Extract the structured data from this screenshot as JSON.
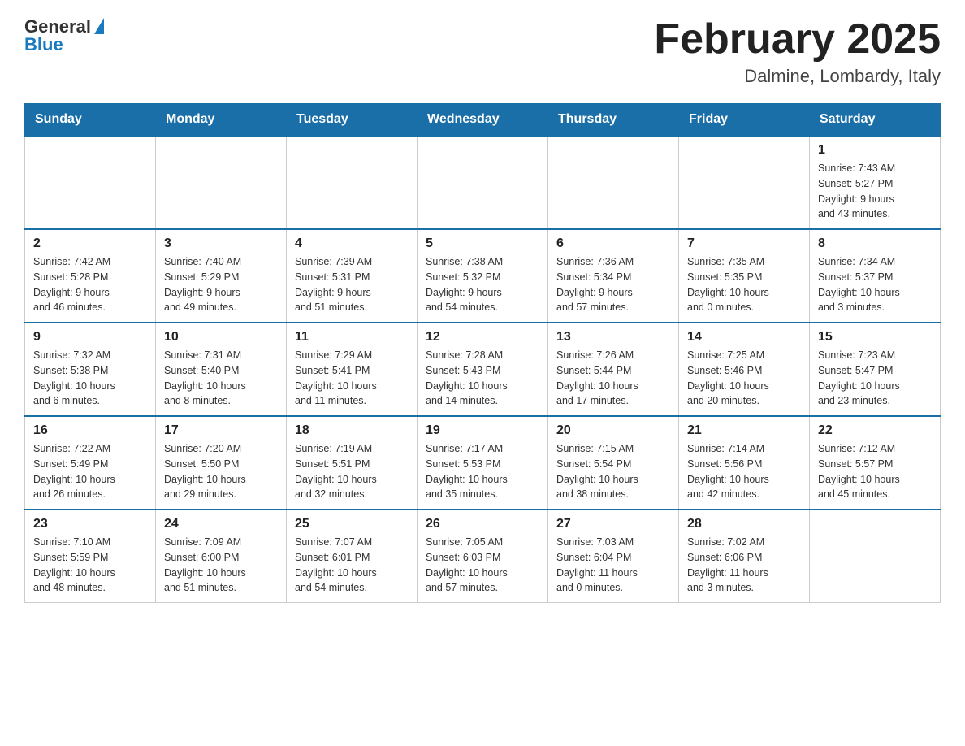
{
  "header": {
    "logo_general": "General",
    "logo_blue": "Blue",
    "title": "February 2025",
    "subtitle": "Dalmine, Lombardy, Italy"
  },
  "days_of_week": [
    "Sunday",
    "Monday",
    "Tuesday",
    "Wednesday",
    "Thursday",
    "Friday",
    "Saturday"
  ],
  "weeks": [
    {
      "days": [
        {
          "num": "",
          "info": ""
        },
        {
          "num": "",
          "info": ""
        },
        {
          "num": "",
          "info": ""
        },
        {
          "num": "",
          "info": ""
        },
        {
          "num": "",
          "info": ""
        },
        {
          "num": "",
          "info": ""
        },
        {
          "num": "1",
          "info": "Sunrise: 7:43 AM\nSunset: 5:27 PM\nDaylight: 9 hours\nand 43 minutes."
        }
      ]
    },
    {
      "days": [
        {
          "num": "2",
          "info": "Sunrise: 7:42 AM\nSunset: 5:28 PM\nDaylight: 9 hours\nand 46 minutes."
        },
        {
          "num": "3",
          "info": "Sunrise: 7:40 AM\nSunset: 5:29 PM\nDaylight: 9 hours\nand 49 minutes."
        },
        {
          "num": "4",
          "info": "Sunrise: 7:39 AM\nSunset: 5:31 PM\nDaylight: 9 hours\nand 51 minutes."
        },
        {
          "num": "5",
          "info": "Sunrise: 7:38 AM\nSunset: 5:32 PM\nDaylight: 9 hours\nand 54 minutes."
        },
        {
          "num": "6",
          "info": "Sunrise: 7:36 AM\nSunset: 5:34 PM\nDaylight: 9 hours\nand 57 minutes."
        },
        {
          "num": "7",
          "info": "Sunrise: 7:35 AM\nSunset: 5:35 PM\nDaylight: 10 hours\nand 0 minutes."
        },
        {
          "num": "8",
          "info": "Sunrise: 7:34 AM\nSunset: 5:37 PM\nDaylight: 10 hours\nand 3 minutes."
        }
      ]
    },
    {
      "days": [
        {
          "num": "9",
          "info": "Sunrise: 7:32 AM\nSunset: 5:38 PM\nDaylight: 10 hours\nand 6 minutes."
        },
        {
          "num": "10",
          "info": "Sunrise: 7:31 AM\nSunset: 5:40 PM\nDaylight: 10 hours\nand 8 minutes."
        },
        {
          "num": "11",
          "info": "Sunrise: 7:29 AM\nSunset: 5:41 PM\nDaylight: 10 hours\nand 11 minutes."
        },
        {
          "num": "12",
          "info": "Sunrise: 7:28 AM\nSunset: 5:43 PM\nDaylight: 10 hours\nand 14 minutes."
        },
        {
          "num": "13",
          "info": "Sunrise: 7:26 AM\nSunset: 5:44 PM\nDaylight: 10 hours\nand 17 minutes."
        },
        {
          "num": "14",
          "info": "Sunrise: 7:25 AM\nSunset: 5:46 PM\nDaylight: 10 hours\nand 20 minutes."
        },
        {
          "num": "15",
          "info": "Sunrise: 7:23 AM\nSunset: 5:47 PM\nDaylight: 10 hours\nand 23 minutes."
        }
      ]
    },
    {
      "days": [
        {
          "num": "16",
          "info": "Sunrise: 7:22 AM\nSunset: 5:49 PM\nDaylight: 10 hours\nand 26 minutes."
        },
        {
          "num": "17",
          "info": "Sunrise: 7:20 AM\nSunset: 5:50 PM\nDaylight: 10 hours\nand 29 minutes."
        },
        {
          "num": "18",
          "info": "Sunrise: 7:19 AM\nSunset: 5:51 PM\nDaylight: 10 hours\nand 32 minutes."
        },
        {
          "num": "19",
          "info": "Sunrise: 7:17 AM\nSunset: 5:53 PM\nDaylight: 10 hours\nand 35 minutes."
        },
        {
          "num": "20",
          "info": "Sunrise: 7:15 AM\nSunset: 5:54 PM\nDaylight: 10 hours\nand 38 minutes."
        },
        {
          "num": "21",
          "info": "Sunrise: 7:14 AM\nSunset: 5:56 PM\nDaylight: 10 hours\nand 42 minutes."
        },
        {
          "num": "22",
          "info": "Sunrise: 7:12 AM\nSunset: 5:57 PM\nDaylight: 10 hours\nand 45 minutes."
        }
      ]
    },
    {
      "days": [
        {
          "num": "23",
          "info": "Sunrise: 7:10 AM\nSunset: 5:59 PM\nDaylight: 10 hours\nand 48 minutes."
        },
        {
          "num": "24",
          "info": "Sunrise: 7:09 AM\nSunset: 6:00 PM\nDaylight: 10 hours\nand 51 minutes."
        },
        {
          "num": "25",
          "info": "Sunrise: 7:07 AM\nSunset: 6:01 PM\nDaylight: 10 hours\nand 54 minutes."
        },
        {
          "num": "26",
          "info": "Sunrise: 7:05 AM\nSunset: 6:03 PM\nDaylight: 10 hours\nand 57 minutes."
        },
        {
          "num": "27",
          "info": "Sunrise: 7:03 AM\nSunset: 6:04 PM\nDaylight: 11 hours\nand 0 minutes."
        },
        {
          "num": "28",
          "info": "Sunrise: 7:02 AM\nSunset: 6:06 PM\nDaylight: 11 hours\nand 3 minutes."
        },
        {
          "num": "",
          "info": ""
        }
      ]
    }
  ]
}
